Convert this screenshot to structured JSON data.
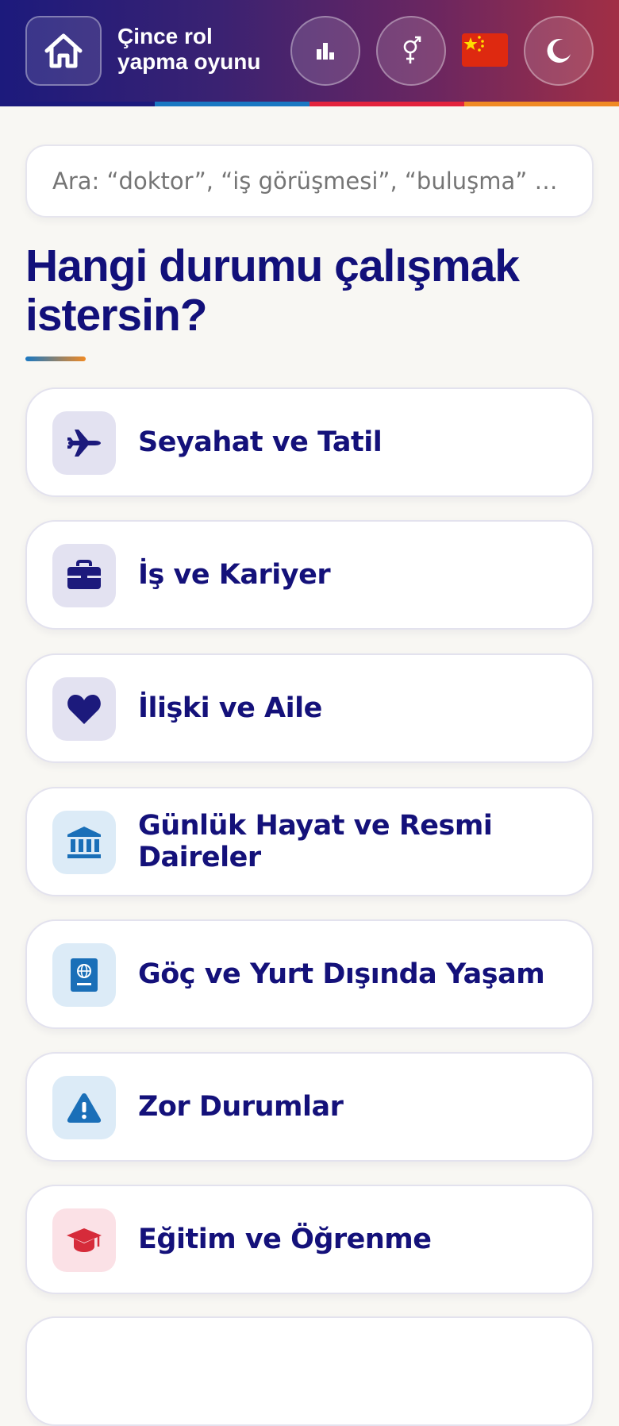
{
  "header": {
    "app_title": "Çince rol yapma oyunu",
    "stripe_colors": [
      "#1c1a7c",
      "#1a78c2",
      "#e3233d",
      "#f08a24"
    ],
    "buttons": {
      "home": "home-icon",
      "stats": "bar-chart-icon",
      "gender": "gender-icon",
      "language": "china-flag-icon",
      "theme": "moon-icon"
    }
  },
  "search": {
    "placeholder": "Ara: “doktor”, “iş görüşmesi”, “buluşma” …"
  },
  "main": {
    "heading": "Hangi durumu çalışmak istersin?",
    "categories": [
      {
        "label": "Seyahat ve Tatil",
        "icon": "airplane-icon",
        "color": "#1c1a7c"
      },
      {
        "label": "İş ve Kariyer",
        "icon": "briefcase-icon",
        "color": "#1c1a7c"
      },
      {
        "label": "İlişki ve Aile",
        "icon": "heart-icon",
        "color": "#1c1a7c"
      },
      {
        "label": "Günlük Hayat ve Resmi Daireler",
        "icon": "bank-icon",
        "color": "#1a6fb8"
      },
      {
        "label": "Göç ve Yurt Dışında Yaşam",
        "icon": "passport-icon",
        "color": "#1a6fb8"
      },
      {
        "label": "Zor Durumlar",
        "icon": "warning-icon",
        "color": "#1a6fb8"
      },
      {
        "label": "Eğitim ve Öğrenme",
        "icon": "graduation-cap-icon",
        "color": "#d62b3a"
      }
    ]
  }
}
